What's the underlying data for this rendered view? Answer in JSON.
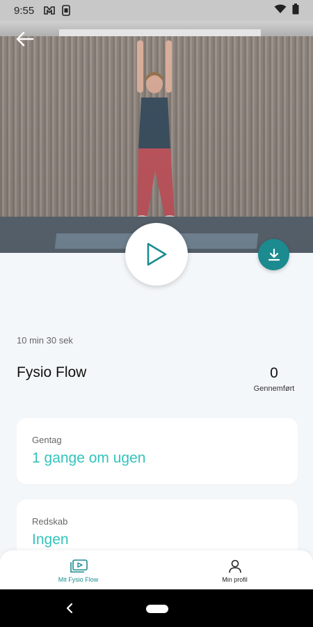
{
  "status_bar": {
    "time": "9:55",
    "icons": [
      "notification-icon",
      "sim-icon",
      "wifi-icon",
      "battery-icon"
    ]
  },
  "header": {
    "back_icon": "arrow-left-icon"
  },
  "video": {
    "play_icon": "play-icon",
    "download_icon": "download-icon"
  },
  "program": {
    "duration": "10 min 30 sek",
    "title": "Fysio Flow",
    "completed_count": "0",
    "completed_label": "Gennemført"
  },
  "cards": {
    "repeat": {
      "label": "Gentag",
      "value": "1 gange om ugen"
    },
    "equipment": {
      "label": "Redskab",
      "value": "Ingen"
    }
  },
  "bottom_nav": {
    "items": [
      {
        "label": "Mit Fysio Flow",
        "icon": "video-library-icon",
        "active": true
      },
      {
        "label": "Min profil",
        "icon": "person-icon",
        "active": false
      }
    ]
  },
  "system_nav": {
    "back_icon": "chevron-left-icon",
    "home_icon": "home-pill-icon"
  },
  "colors": {
    "accent": "#34c3bb",
    "primary": "#1b8b8f",
    "background": "#f4f7f9"
  }
}
